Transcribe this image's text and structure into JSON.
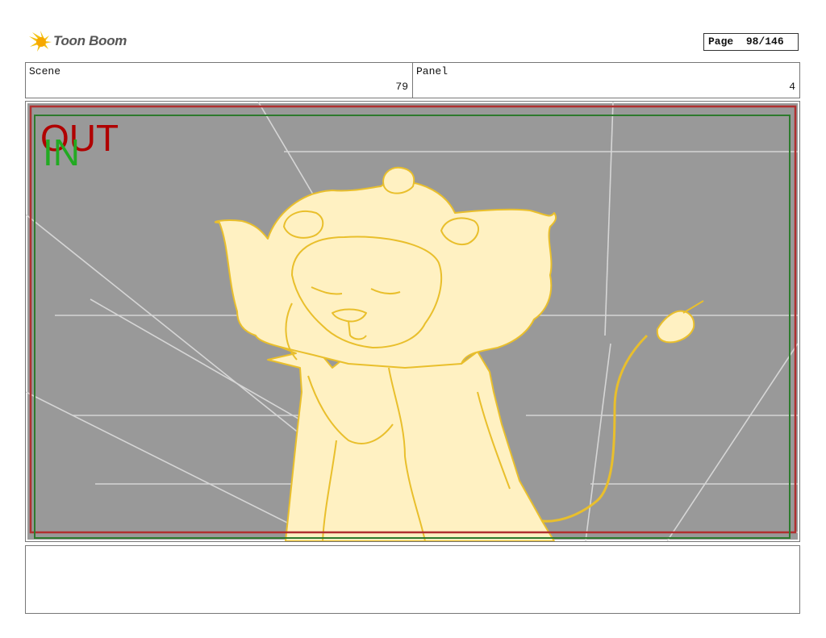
{
  "header": {
    "logo_text": "Toon Boom",
    "page_label": "Page",
    "page_value": "98/146"
  },
  "info": {
    "scene_label": "Scene",
    "scene_value": "79",
    "panel_label": "Panel",
    "panel_value": "4"
  },
  "panel_image": {
    "out_marker": "OUT",
    "in_marker": "IN",
    "colors": {
      "background": "#999999",
      "out_frame": "#b03030",
      "in_frame": "#2d7a2d",
      "lion_fill": "#fff1c2",
      "lion_line": "#e9bf2c",
      "guide_lines": "#d6d6d6"
    }
  },
  "notes": {
    "text": ""
  }
}
